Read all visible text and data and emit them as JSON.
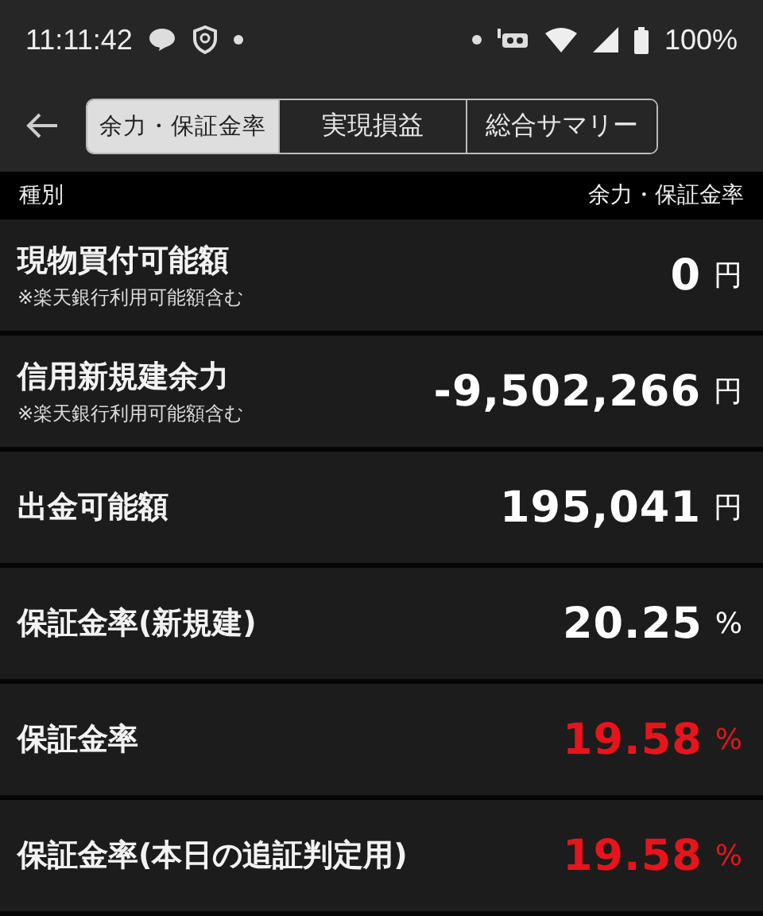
{
  "status_bar": {
    "time": "11:11:42",
    "battery": "100%"
  },
  "tabs": [
    {
      "label": "余力・保証金率",
      "selected": true
    },
    {
      "label": "実現損益",
      "selected": false
    },
    {
      "label": "総合サマリー",
      "selected": false
    }
  ],
  "table": {
    "columns": [
      "種別",
      "余力・保証金率"
    ],
    "rows": [
      {
        "label": "現物買付可能額",
        "note": "※楽天銀行利用可能額含む",
        "value": "0",
        "unit": "円",
        "color": "#ffffff"
      },
      {
        "label": "信用新規建余力",
        "note": "※楽天銀行利用可能額含む",
        "value": "-9,502,266",
        "unit": "円",
        "color": "#ffffff"
      },
      {
        "label": "出金可能額",
        "value": "195,041",
        "unit": "円",
        "color": "#ffffff"
      },
      {
        "label": "保証金率(新規建)",
        "value": "20.25",
        "unit": "%",
        "color": "#ffffff"
      },
      {
        "label": "保証金率",
        "value": "19.58",
        "unit": "%",
        "color": "#e8141c"
      },
      {
        "label": "保証金率(本日の追証判定用)",
        "value": "19.58",
        "unit": "%",
        "color": "#e8141c"
      }
    ]
  }
}
